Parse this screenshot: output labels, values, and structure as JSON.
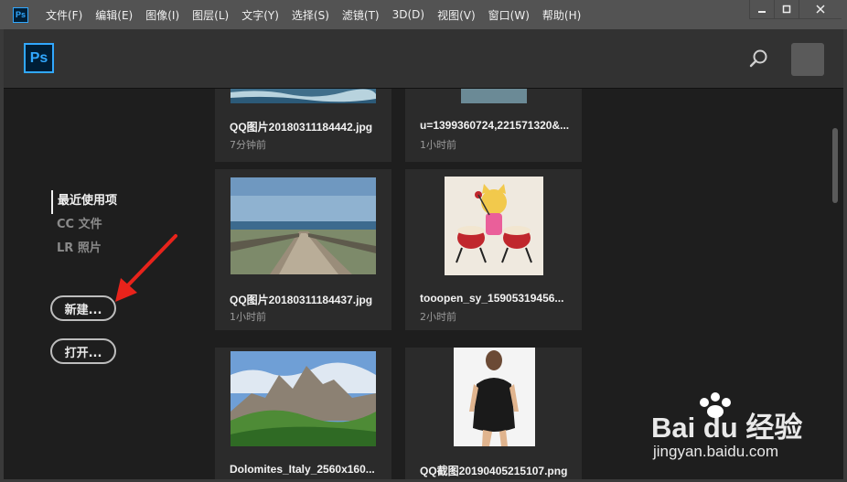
{
  "app": {
    "small_logo": "Ps",
    "logo": "Ps"
  },
  "menu": [
    "文件(F)",
    "编辑(E)",
    "图像(I)",
    "图层(L)",
    "文字(Y)",
    "选择(S)",
    "滤镜(T)",
    "3D(D)",
    "视图(V)",
    "窗口(W)",
    "帮助(H)"
  ],
  "sidebar": {
    "nav": [
      "最近使用项",
      "CC 文件",
      "LR 照片"
    ],
    "new_button": "新建...",
    "open_button": "打开..."
  },
  "recent_files": [
    {
      "name": "QQ图片20180311184442.jpg",
      "time": "7分钟前"
    },
    {
      "name": "u=1399360724,221571320&...",
      "time": "1小时前"
    },
    {
      "name": "QQ图片20180311184437.jpg",
      "time": "1小时前"
    },
    {
      "name": "tooopen_sy_15905319456...",
      "time": "2小时前"
    },
    {
      "name": "Dolomites_Italy_2560x160...",
      "time": ""
    },
    {
      "name": "QQ截图20190405215107.png",
      "time": ""
    }
  ],
  "watermark": {
    "brand": "Bai du 经验",
    "url": "jingyan.baidu.com"
  },
  "colors": {
    "accent": "#31a8ff",
    "bg": "#1e1e1e",
    "card": "#2b2b2b",
    "header": "#323232",
    "menubar": "#535353"
  }
}
